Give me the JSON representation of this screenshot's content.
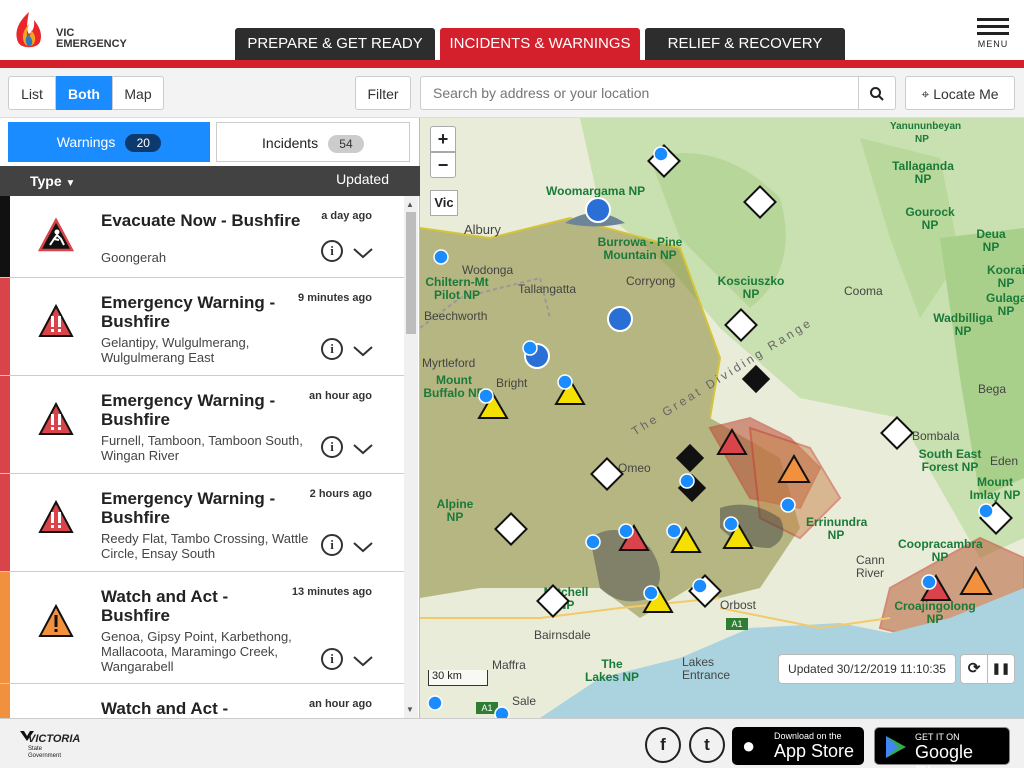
{
  "brand": {
    "line1": "VIC",
    "line2": "EMERGENCY"
  },
  "nav": {
    "tabs": [
      {
        "label": "PREPARE & GET READY",
        "active": false
      },
      {
        "label": "INCIDENTS & WARNINGS",
        "active": true
      },
      {
        "label": "RELIEF & RECOVERY",
        "active": false
      }
    ],
    "menu_label": "MENU"
  },
  "toolbar": {
    "view_list": "List",
    "view_both": "Both",
    "view_map": "Map",
    "filter": "Filter",
    "search_placeholder": "Search by address or your location",
    "locate": "Locate Me"
  },
  "sidebar": {
    "warnings_tab": "Warnings",
    "warnings_count": "20",
    "incidents_tab": "Incidents",
    "incidents_count": "54",
    "sort_type": "Type",
    "sort_updated": "Updated",
    "items": [
      {
        "title": "Evacuate Now - Bushfire",
        "locations": "Goongerah",
        "time": "a day ago",
        "level": "evacuate"
      },
      {
        "title": "Emergency Warning - Bushfire",
        "locations": "Gelantipy, Wulgulmerang, Wulgulmerang East",
        "time": "9 minutes ago",
        "level": "emergency"
      },
      {
        "title": "Emergency Warning - Bushfire",
        "locations": "Furnell, Tamboon, Tamboon South, Wingan River",
        "time": "an hour ago",
        "level": "emergency"
      },
      {
        "title": "Emergency Warning - Bushfire",
        "locations": "Reedy Flat, Tambo Crossing, Wattle Circle, Ensay South",
        "time": "2 hours ago",
        "level": "emergency"
      },
      {
        "title": "Watch and Act - Bushfire",
        "locations": "Genoa, Gipsy Point, Karbethong, Mallacoota, Maramingo Creek, Wangarabell",
        "time": "13 minutes ago",
        "level": "watch"
      },
      {
        "title": "Watch and Act -",
        "locations": "",
        "time": "an hour ago",
        "level": "watch"
      }
    ]
  },
  "map": {
    "zoom_in": "+",
    "zoom_out": "−",
    "state_btn": "Vic",
    "scale": "30 km",
    "updated": "Updated 30/12/2019 11:10:35",
    "parks": [
      {
        "name": "Woomargama NP"
      },
      {
        "name": "Burrowa - Pine Mountain NP"
      },
      {
        "name": "Chiltern-Mt Pilot NP"
      },
      {
        "name": "Kosciuszko NP"
      },
      {
        "name": "Mount Buffalo NP"
      },
      {
        "name": "Alpine NP"
      },
      {
        "name": "Yanununbeyan NP"
      },
      {
        "name": "Tallaganda NP"
      },
      {
        "name": "Gourock NP"
      },
      {
        "name": "Deua NP"
      },
      {
        "name": "Wadbilliga NP"
      },
      {
        "name": "South East Forest NP"
      },
      {
        "name": "Mount Imlay NP"
      },
      {
        "name": "Coopracambra NP"
      },
      {
        "name": "The Lakes NP"
      },
      {
        "name": "Croajingolong NP"
      },
      {
        "name": "Mitchell NP"
      },
      {
        "name": "Errinundra NP"
      },
      {
        "name": "Koorai NP"
      },
      {
        "name": "Gulaga NP"
      }
    ],
    "towns": [
      "Albury",
      "Wodonga",
      "Tallangatta",
      "Corryong",
      "Beechworth",
      "Bright",
      "Omeo",
      "Cooma",
      "Bombala",
      "Bega",
      "Eden",
      "Cann River",
      "Orbost",
      "Bairnsdale",
      "Maffra",
      "Lakes Entrance",
      "Sale",
      "Myrtleford",
      "The Great Dividing Range"
    ],
    "roads": [
      "A1",
      "A1"
    ]
  },
  "footer": {
    "victoria": "VICTORIA",
    "victoria_sub": "State Government",
    "facebook": "f",
    "twitter": "t",
    "appstore_small": "Download on the",
    "appstore_big": "App Store",
    "gplay_small": "GET IT ON",
    "gplay_big": "Google Play"
  },
  "colors": {
    "brand_red": "#d3202c",
    "nav_dark": "#2d2d2d",
    "active_blue": "#1a8cff",
    "evacuate": "#111111",
    "emergency": "#d9434a",
    "watch": "#f2913d",
    "fire_zone": "#8a8a3a"
  }
}
